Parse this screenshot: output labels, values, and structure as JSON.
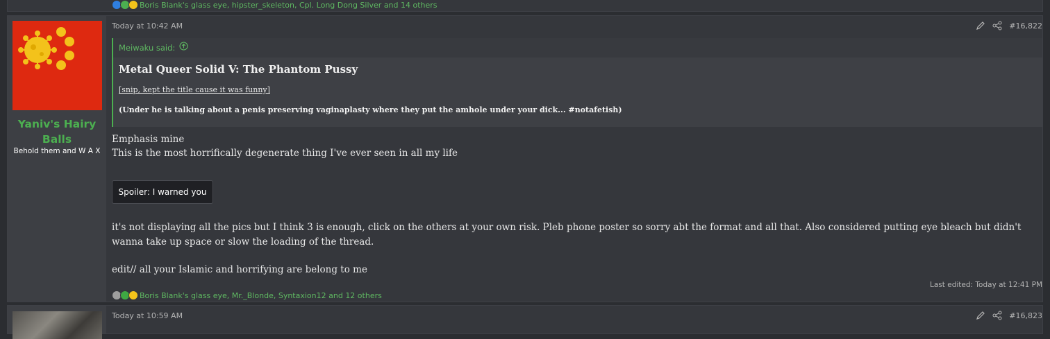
{
  "colors": {
    "page_bg": "#2b2d31",
    "post_bg": "#35373c",
    "accent_green": "#4caf50",
    "avatar_red": "#de2910",
    "virus_yellow": "#f3c21b"
  },
  "top_post": {
    "reactions_text": "Boris Blank's glass eye, hipster_skeleton, Cpl. Long Dong Silver and 14 others",
    "reaction_icons": [
      "thumbs-up-icon",
      "check-icon",
      "laughing-face-icon"
    ]
  },
  "main_post": {
    "username": "Yaniv's Hairy Balls",
    "user_title": "Behold them and W A X",
    "avatar_icon": "virus-flag-avatar",
    "timestamp": "Today at 10:42 AM",
    "post_number": "#16,822",
    "quote": {
      "author_label": "Meiwaku said:",
      "title": "Metal Queer Solid V: The Phantom Pussy",
      "snip": "[snip, kept the title cause it was funny]",
      "note": "(Under he is talking about a penis preserving vaginaplasty where they put the amhole under your dick... #notafetish)"
    },
    "line1": "Emphasis mine",
    "line2": "This is the most horrifically degenerate thing I've ever seen in all my life",
    "spoiler_label": "Spoiler: I warned you",
    "paragraph1": "it's not displaying all the pics but I think 3 is enough, click on the others at your own risk. Pleb phone poster so sorry abt the format and all that. Also considered putting eye bleach but didn't wanna take up space or slow the loading of the thread.",
    "paragraph2": "edit// all your Islamic and horrifying are belong to me",
    "last_edited": "Last edited: Today at 12:41 PM",
    "reactions_text": "Boris Blank's glass eye, Mr._Blonde, Syntaxion12 and 12 others",
    "reaction_icons": [
      "bone-icon",
      "x-icon",
      "laughing-face-icon"
    ]
  },
  "next_post": {
    "timestamp": "Today at 10:59 AM",
    "post_number": "#16,823"
  }
}
